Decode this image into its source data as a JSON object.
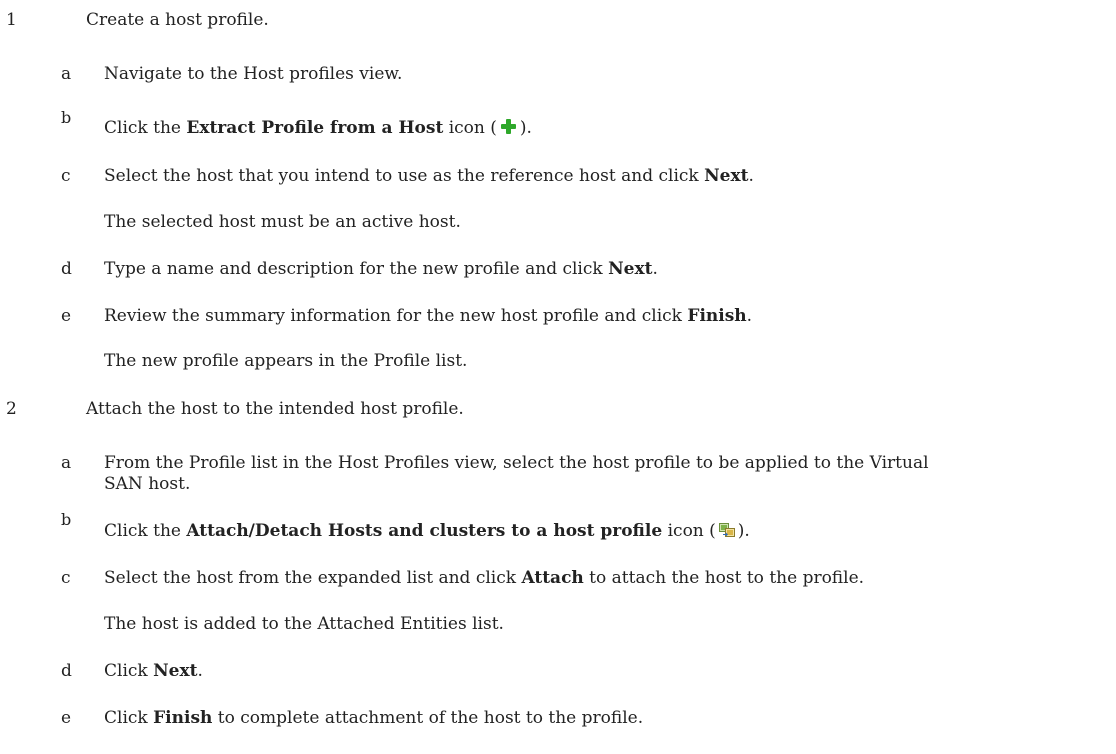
{
  "steps": [
    {
      "number": "1",
      "title": "Create a host profile.",
      "substeps": [
        {
          "letter": "a",
          "text": "Navigate to the Host profiles view."
        },
        {
          "letter": "b",
          "pre": "Click the ",
          "bold": "Extract Profile from a Host",
          "post_icon_pre": " icon (",
          "post_icon_post": ").",
          "icon": "add-profile-plus-icon"
        },
        {
          "letter": "c",
          "pre": "Select the host that you intend to use as the reference host and click ",
          "bold": "Next",
          "post": ".",
          "note": "The selected host must be an active host."
        },
        {
          "letter": "d",
          "pre": "Type a name and description for the new profile and click ",
          "bold": "Next",
          "post": "."
        },
        {
          "letter": "e",
          "pre": "Review the summary information for the new host profile and click ",
          "bold": "Finish",
          "post": ".",
          "note": "The new profile appears in the Profile list."
        }
      ]
    },
    {
      "number": "2",
      "title": "Attach the host to the intended host profile.",
      "substeps": [
        {
          "letter": "a",
          "text_line1": "From the Profile list in the Host Profiles view, select the host profile to be applied to the Virtual",
          "text_line2": "SAN host."
        },
        {
          "letter": "b",
          "pre": "Click the ",
          "bold": "Attach/Detach Hosts and clusters to a host profile",
          "post_icon_pre": " icon (",
          "post_icon_post": ").",
          "icon": "attach-detach-hosts-icon"
        },
        {
          "letter": "c",
          "pre": "Select the host from the expanded list and click ",
          "bold": "Attach",
          "post": " to attach the host to the profile.",
          "note": "The host is added to the Attached Entities list."
        },
        {
          "letter": "d",
          "pre": "Click ",
          "bold": "Next",
          "post": "."
        },
        {
          "letter": "e",
          "pre": "Click ",
          "bold": "Finish",
          "post": " to complete attachment of the host to the profile."
        }
      ]
    }
  ],
  "colors": {
    "text": "#222222",
    "plus_icon": "#2ea82a"
  }
}
